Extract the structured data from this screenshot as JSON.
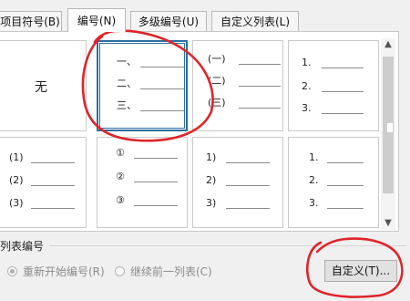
{
  "tabs": [
    {
      "label": "项目符号(B)",
      "active": false
    },
    {
      "label": "编号(N)",
      "active": true
    },
    {
      "label": "多级编号(U)",
      "active": false
    },
    {
      "label": "自定义列表(L)",
      "active": false
    }
  ],
  "gallery": {
    "none_label": "无",
    "styles": [
      {
        "markers": []
      },
      {
        "markers": [
          "一、",
          "二、",
          "三、"
        ],
        "selected": true
      },
      {
        "markers": [
          "(一)",
          "(二)",
          "(三)"
        ]
      },
      {
        "markers": [
          "1.",
          "2.",
          "3."
        ]
      },
      {
        "markers": [
          "(1)",
          "(2)",
          "(3)"
        ]
      },
      {
        "markers": [
          "①",
          "②",
          "③"
        ]
      },
      {
        "markers": [
          "1)",
          "2)",
          "3)"
        ]
      },
      {
        "markers": [
          "1.",
          "2.",
          "3."
        ]
      }
    ]
  },
  "list_numbering": {
    "title": "列表编号",
    "restart_label": "重新开始编号(R)",
    "restart_checked": true,
    "continue_label": "继续前一列表(C)",
    "continue_checked": false
  },
  "customize_button_label": "自定义(T)...",
  "annotation_color": "#e0242a",
  "selection_color": "#2b6ea0"
}
